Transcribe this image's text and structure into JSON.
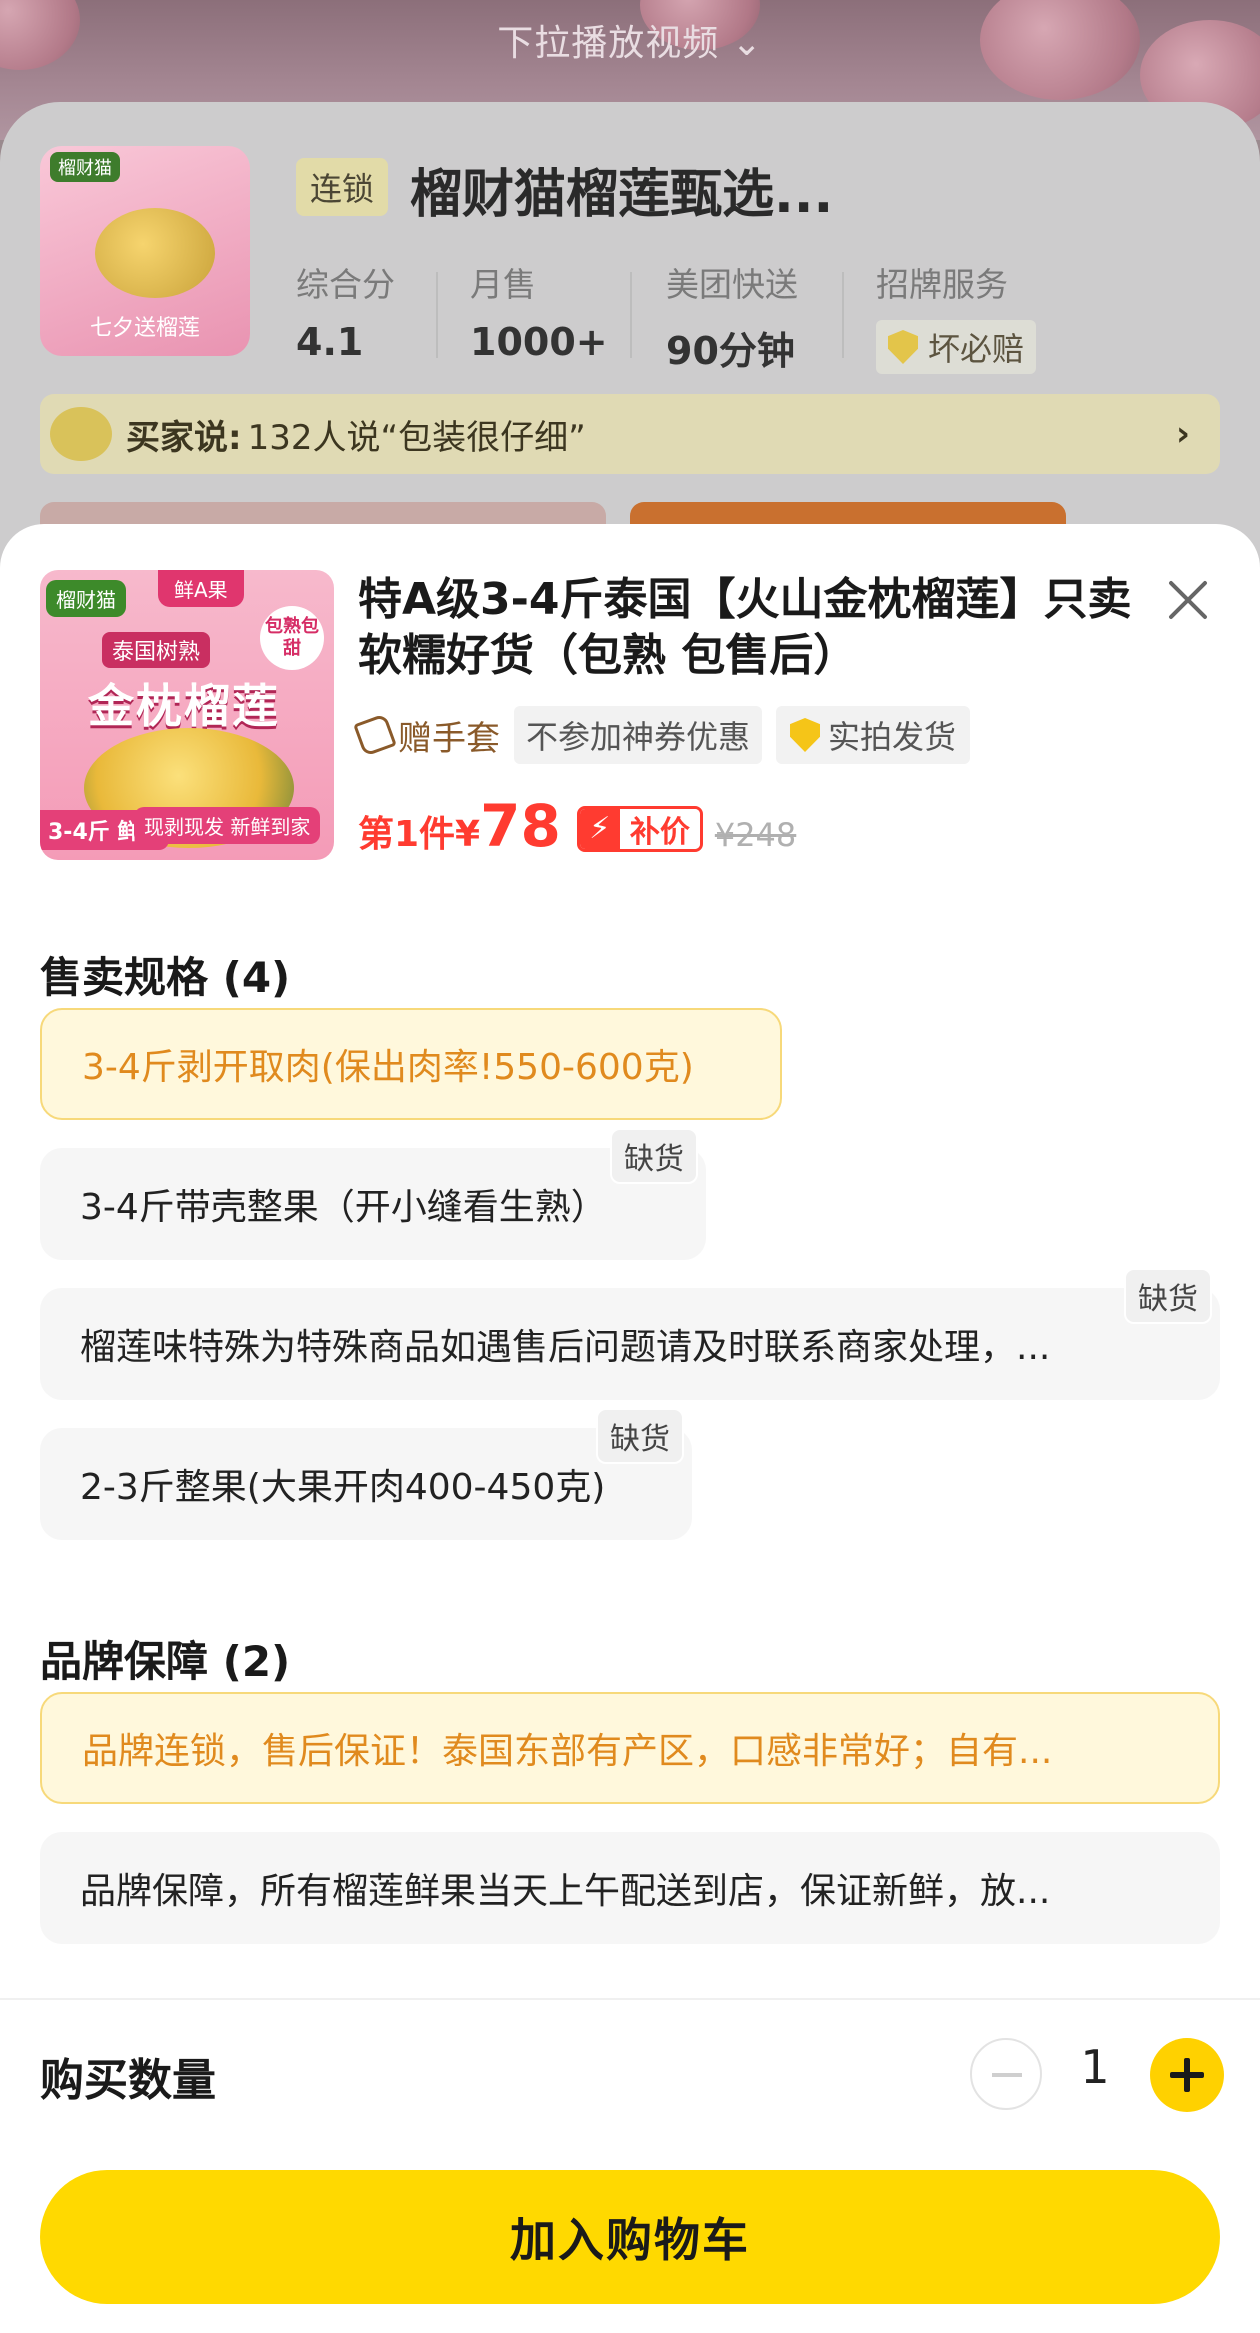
{
  "pull_hint": "下拉播放视频 ⌄",
  "store": {
    "logo_brand": "榴财猫",
    "logo_caption": "七夕送榴莲",
    "chain_tag": "连锁",
    "name": "榴财猫榴莲甄选...",
    "stats": [
      {
        "label": "综合分",
        "value": "4.1"
      },
      {
        "label": "月售",
        "value": "1000+"
      },
      {
        "label": "美团快送",
        "value": "90分钟"
      },
      {
        "label": "招牌服务",
        "value": "坏必赔"
      }
    ],
    "review_label": "买家说:",
    "review_text": "132人说“包装很仔细”",
    "review_arrow": "›"
  },
  "product": {
    "image": {
      "brand": "榴财猫",
      "grade": "鲜A果",
      "sub": "泰国树熟",
      "title": "金枕榴莲",
      "cooked": "包熟包甜",
      "weight": "3-4斤 鲜果",
      "slogan": "现剥现发 新鲜到家"
    },
    "title": "特A级3-4斤泰国【火山金枕榴莲】只卖软糯好货（包熟 包售后）",
    "tags": {
      "gift": "赠手套",
      "no_coupon": "不参加神券优惠",
      "real_photo": "实拍发货"
    },
    "price_prefix": "第1件¥",
    "price_value": "78",
    "subsidy_bolt": "⚡",
    "subsidy_text": "补价",
    "original_price": "¥248"
  },
  "spec_section": {
    "title": "售卖规格 (4)",
    "out_of_stock": "缺货",
    "options": [
      {
        "label": "3-4斤剥开取肉(保出肉率!550-600克)",
        "selected": true,
        "oos": false
      },
      {
        "label": "3-4斤带壳整果（开小缝看生熟）",
        "selected": false,
        "oos": true
      },
      {
        "label": "榴莲味特殊为特殊商品如遇售后问题请及时联系商家处理，...",
        "selected": false,
        "oos": true
      },
      {
        "label": "2-3斤整果(大果开肉400-450克)",
        "selected": false,
        "oos": true
      }
    ]
  },
  "brand_section": {
    "title": "品牌保障 (2)",
    "options": [
      {
        "label": "品牌连锁，售后保证！泰国东部有产区，口感非常好；自有...",
        "selected": true
      },
      {
        "label": "品牌保障，所有榴莲鲜果当天上午配送到店，保证新鲜，放...",
        "selected": false
      }
    ]
  },
  "quantity": {
    "label": "购买数量",
    "value": "1"
  },
  "cart_button": "加入购物车",
  "colors": {
    "accent_yellow": "#ffd900",
    "price_red": "#ff3b30",
    "selected_text": "#e08a1e"
  }
}
